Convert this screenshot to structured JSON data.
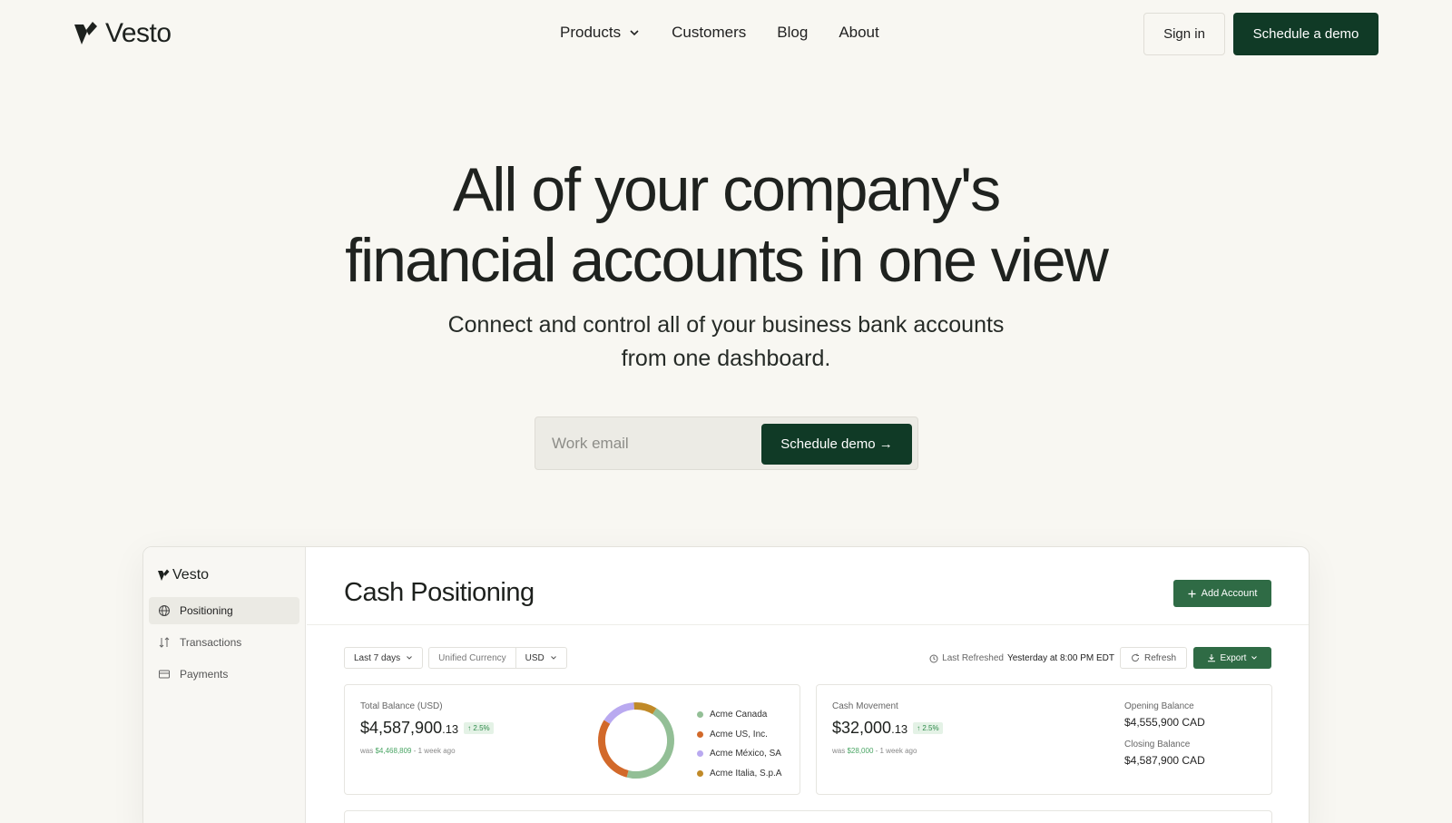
{
  "nav": {
    "logo": "Vesto",
    "links": [
      "Products",
      "Customers",
      "Blog",
      "About"
    ],
    "sign_in": "Sign in",
    "schedule_demo": "Schedule a demo"
  },
  "hero": {
    "title_line1": "All of your company's",
    "title_line2": "financial accounts in one view",
    "subtitle_line1": "Connect and control all of your business bank accounts",
    "subtitle_line2": "from one dashboard.",
    "email_placeholder": "Work email",
    "cta": "Schedule demo →"
  },
  "app": {
    "logo": "Vesto",
    "sidebar": [
      {
        "label": "Positioning",
        "icon": "globe-icon",
        "active": true
      },
      {
        "label": "Transactions",
        "icon": "sort-arrows-icon",
        "active": false
      },
      {
        "label": "Payments",
        "icon": "card-icon",
        "active": false
      }
    ],
    "title": "Cash Positioning",
    "add_account": "Add Account",
    "filters": {
      "range": "Last 7 days",
      "currency_mode": "Unified Currency",
      "currency": "USD"
    },
    "refresh": {
      "label": "Last Refreshed",
      "value": "Yesterday at 8:00 PM EDT",
      "button": "Refresh",
      "export": "Export"
    },
    "total_balance": {
      "label": "Total Balance (USD)",
      "amount": "$4,587,900",
      "cents": ".13",
      "change": "↑ 2.5%",
      "was_prefix": "was",
      "was_value": "$4,468,809",
      "was_suffix": "- 1 week ago",
      "accounts": [
        {
          "name": "Acme Canada",
          "color": "#93bf96",
          "share": 0.45
        },
        {
          "name": "Acme US, Inc.",
          "color": "#d2692a",
          "share": 0.3
        },
        {
          "name": "Acme México, SA",
          "color": "#b9a9f0",
          "share": 0.15
        },
        {
          "name": "Acme Italia, S.p.A",
          "color": "#c08a28",
          "share": 0.1
        }
      ]
    },
    "cash_movement": {
      "label": "Cash Movement",
      "amount": "$32,000",
      "cents": ".13",
      "change": "↑ 2.5%",
      "was_prefix": "was",
      "was_value": "$28,000",
      "was_suffix": "- 1 week ago",
      "opening_label": "Opening Balance",
      "opening_value": "$4,555,900 CAD",
      "closing_label": "Closing Balance",
      "closing_value": "$4,587,900 CAD"
    }
  },
  "colors": {
    "background": "#f8f7f2",
    "brand_dark": "#103a26",
    "brand_green": "#2f6b45"
  }
}
